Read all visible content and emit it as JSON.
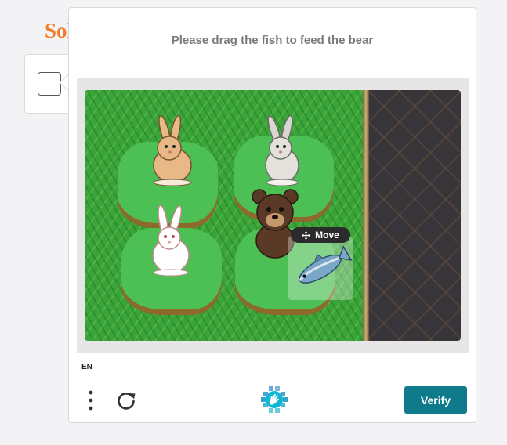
{
  "background_page": {
    "logo_text": "Sol"
  },
  "challenge": {
    "prompt": "Please drag the fish to feed the bear",
    "drag_hint": "Move",
    "language": "EN"
  },
  "footer": {
    "menu_icon": "more-vertical-icon",
    "refresh_icon": "refresh-icon",
    "brand_icon": "hcaptcha-logo",
    "verify_label": "Verify"
  },
  "colors": {
    "accent": "#0f7a8c",
    "logo": "#f47b2a"
  }
}
